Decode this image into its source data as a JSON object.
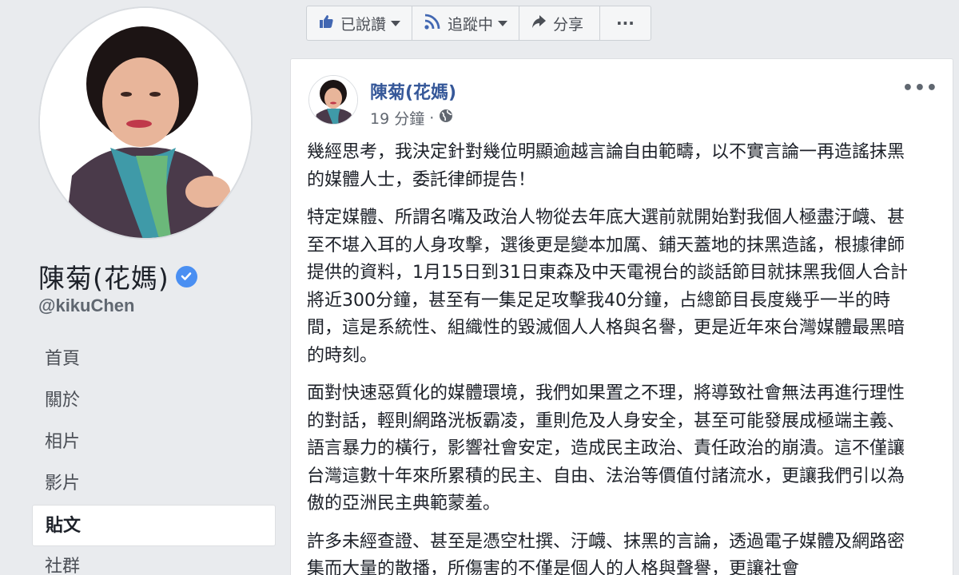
{
  "profile": {
    "name": "陳菊(花媽)",
    "handle": "@kikuChen",
    "verified_icon": "verified-badge-icon"
  },
  "nav": {
    "items": [
      {
        "label": "首頁",
        "active": false
      },
      {
        "label": "關於",
        "active": false
      },
      {
        "label": "相片",
        "active": false
      },
      {
        "label": "影片",
        "active": false
      },
      {
        "label": "貼文",
        "active": true
      },
      {
        "label": "社群",
        "active": false
      }
    ]
  },
  "actionbar": {
    "liked_label": "已說讚",
    "following_label": "追蹤中",
    "share_label": "分享",
    "more_label": "···"
  },
  "post": {
    "author": "陳菊(花媽)",
    "time": "19 分鐘",
    "dot": "·",
    "privacy_icon": "globe-icon",
    "more": "•••",
    "paragraphs": [
      "幾經思考，我決定針對幾位明顯逾越言論自由範疇，以不實言論一再造謠抹黑的媒體人士，委託律師提告！",
      "特定媒體、所謂名嘴及政治人物從去年底大選前就開始對我個人極盡汙衊、甚至不堪入耳的人身攻擊，選後更是變本加厲、鋪天蓋地的抹黑造謠，根據律師提供的資料，1月15日到31日東森及中天電視台的談話節目就抹黑我個人合計將近300分鐘，甚至有一集足足攻擊我40分鐘，占總節目長度幾乎一半的時間，這是系統性、組織性的毀滅個人人格與名譽，更是近年來台灣媒體最黑暗的時刻。",
      "面對快速惡質化的媒體環境，我們如果置之不理，將導致社會無法再進行理性的對話，輕則網路洸板霸凌，重則危及人身安全，甚至可能發展成極端主義、語言暴力的橫行，影響社會安定，造成民主政治、責任政治的崩潰。這不僅讓台灣這數十年來所累積的民主、自由、法治等價值付諸流水，更讓我們引以為傲的亞洲民主典範蒙羞。",
      "許多未經查證、甚至是憑空杜撰、汙衊、抹黑的言論，透過電子媒體及網路密集而大量的散播，所傷害的不僅是個人的人格與聲譽，更讓社會"
    ]
  },
  "colors": {
    "background": "#e9ebee",
    "link": "#365899",
    "verified": "#4a8ff2"
  }
}
